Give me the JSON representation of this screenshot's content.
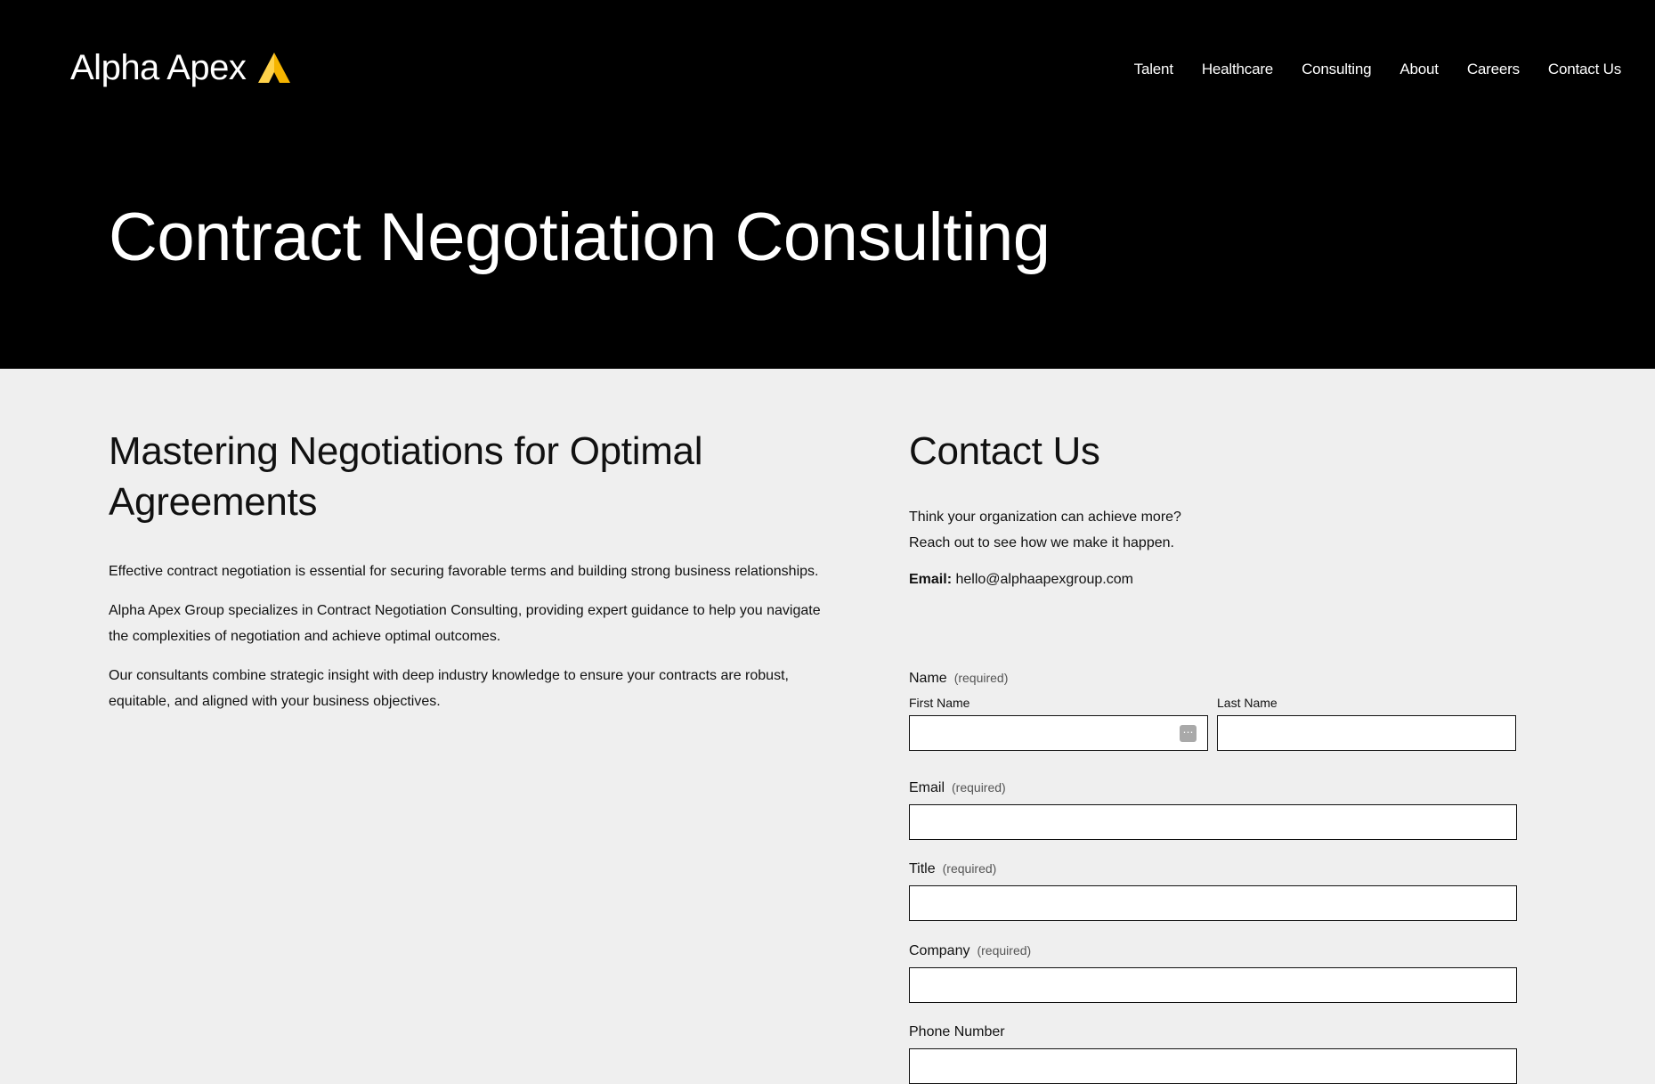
{
  "header": {
    "logo_text": "Alpha Apex",
    "logo_icon": "apex-triangle-icon",
    "accent_color": "#f5b400",
    "nav": [
      {
        "label": "Talent"
      },
      {
        "label": "Healthcare"
      },
      {
        "label": "Consulting"
      },
      {
        "label": "About"
      },
      {
        "label": "Careers"
      },
      {
        "label": "Contact Us"
      }
    ]
  },
  "hero": {
    "title": "Contract Negotiation Consulting"
  },
  "main": {
    "heading": "Mastering Negotiations for Optimal Agreements",
    "paragraphs": [
      "Effective contract negotiation is essential for securing favorable terms and building strong business relationships.",
      "Alpha Apex Group specializes in Contract Negotiation Consulting, providing expert guidance to help you navigate the complexities of negotiation and achieve optimal outcomes.",
      "Our consultants combine strategic insight with deep industry knowledge to ensure your contracts are robust, equitable, and aligned with your business objectives."
    ]
  },
  "contact": {
    "heading": "Contact Us",
    "intro_line1": "Think your organization can achieve more?",
    "intro_line2": "Reach out to see how we make it happen.",
    "email_label": "Email:",
    "email_value": "hello@alphaapexgroup.com",
    "form": {
      "name_label": "Name",
      "required_text": "(required)",
      "first_name_label": "First Name",
      "last_name_label": "Last Name",
      "email_label": "Email",
      "title_label": "Title",
      "company_label": "Company",
      "phone_label": "Phone Number",
      "first_name_value": "",
      "last_name_value": "",
      "email_value": "",
      "title_value": "",
      "company_value": "",
      "phone_value": ""
    }
  }
}
